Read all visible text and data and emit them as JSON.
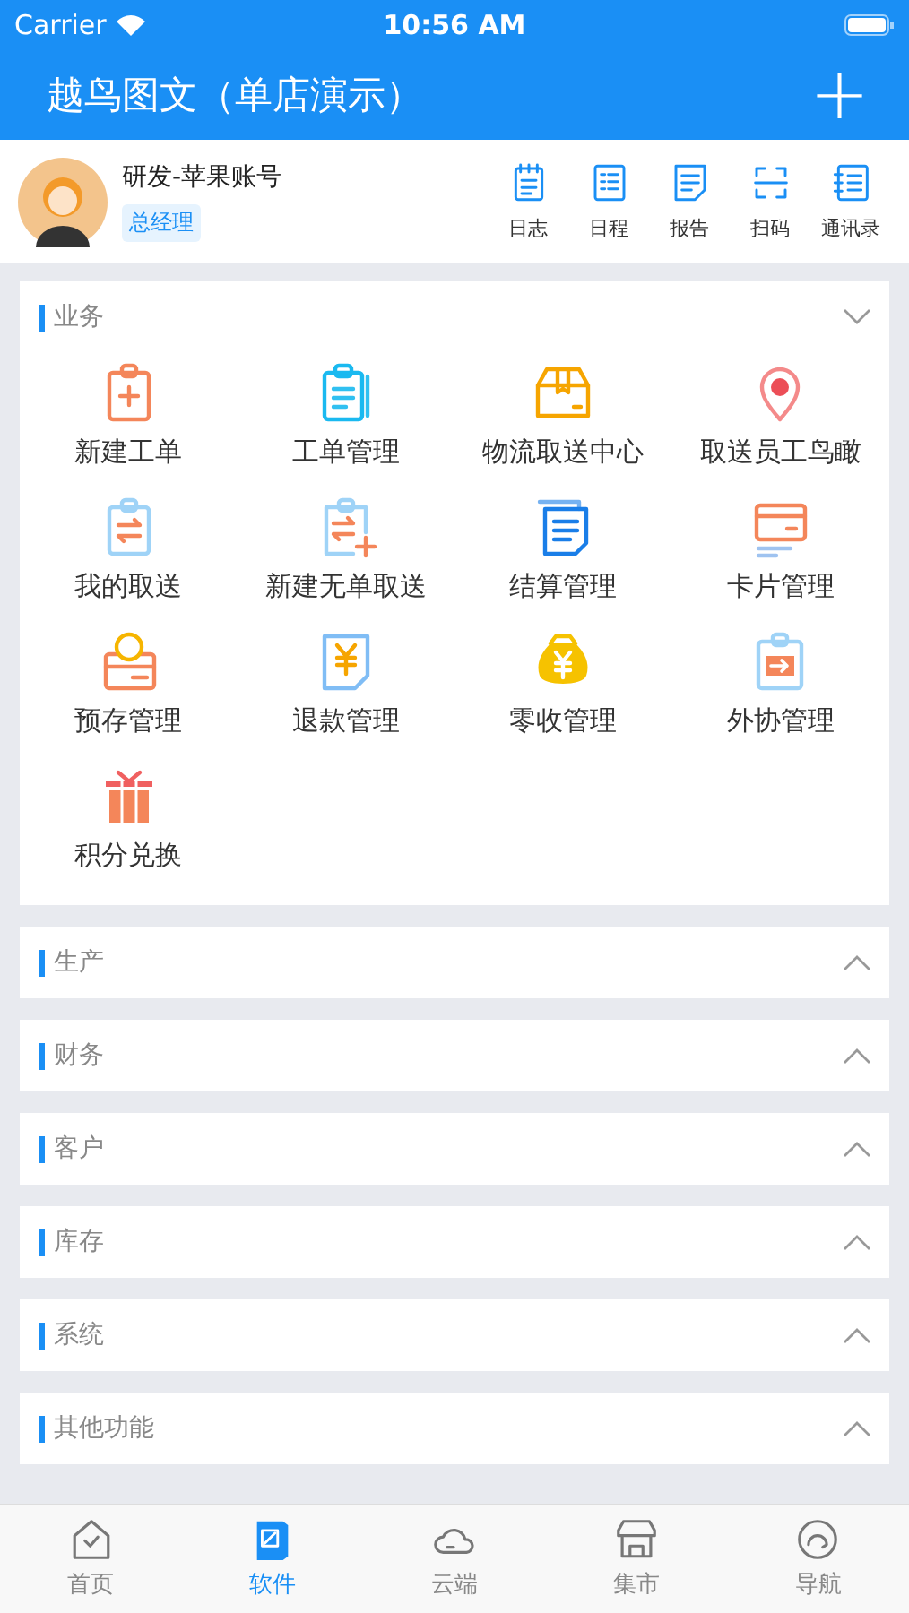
{
  "status_bar": {
    "carrier": "Carrier",
    "time": "10:56 AM"
  },
  "nav_bar": {
    "title": "越鸟图文（单店演示）",
    "action": "+"
  },
  "profile": {
    "name": "研发-苹果账号",
    "role": "总经理"
  },
  "quick_actions": [
    {
      "label": "日志"
    },
    {
      "label": "日程"
    },
    {
      "label": "报告"
    },
    {
      "label": "扫码"
    },
    {
      "label": "通讯录"
    }
  ],
  "sections": [
    {
      "title": "业务",
      "expanded": true,
      "items": [
        {
          "label": "新建工单"
        },
        {
          "label": "工单管理"
        },
        {
          "label": "物流取送中心"
        },
        {
          "label": "取送员工鸟瞰"
        },
        {
          "label": "我的取送"
        },
        {
          "label": "新建无单取送"
        },
        {
          "label": "结算管理"
        },
        {
          "label": "卡片管理"
        },
        {
          "label": "预存管理"
        },
        {
          "label": "退款管理"
        },
        {
          "label": "零收管理"
        },
        {
          "label": "外协管理"
        },
        {
          "label": "积分兑换"
        }
      ]
    },
    {
      "title": "生产",
      "expanded": false
    },
    {
      "title": "财务",
      "expanded": false
    },
    {
      "title": "客户",
      "expanded": false
    },
    {
      "title": "库存",
      "expanded": false
    },
    {
      "title": "系统",
      "expanded": false
    },
    {
      "title": "其他功能",
      "expanded": false
    }
  ],
  "tab_bar": [
    {
      "label": "首页",
      "selected": false
    },
    {
      "label": "软件",
      "selected": true
    },
    {
      "label": "云端",
      "selected": false
    },
    {
      "label": "集市",
      "selected": false
    },
    {
      "label": "导航",
      "selected": false
    }
  ]
}
